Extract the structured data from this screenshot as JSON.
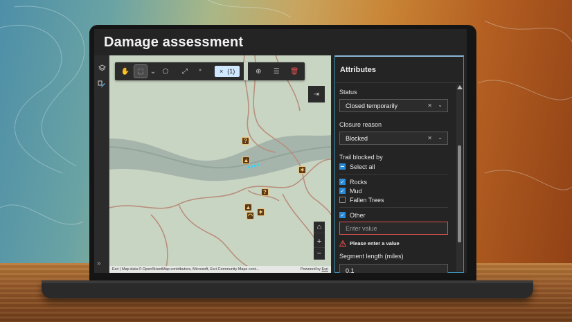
{
  "app": {
    "title": "Damage assessment"
  },
  "rail": {
    "expand_glyph": "»",
    "icons": [
      "layers-icon",
      "edit-feature-icon"
    ]
  },
  "toolbar": {
    "selection_count_label": "(1)",
    "clear_glyph": "×",
    "icons": [
      "pan-hand-icon",
      "select-rectangle-icon",
      "dropdown-chevron-icon",
      "select-by-polygon-icon",
      "select-by-line-icon",
      "select-by-point-icon",
      "zoom-to-icon",
      "filter-icon",
      "trash-icon"
    ]
  },
  "map": {
    "attribution_left": "Esri | Map data © OpenStreetMap contributors, Microsoft, Esri Community Maps cont...",
    "attribution_right_prefix": "Powered by ",
    "attribution_right_link": "Esri",
    "zoom_in": "+",
    "zoom_out": "−",
    "markers": [
      {
        "kind": "question-marker-icon",
        "glyph": "?"
      },
      {
        "kind": "closure-marker-icon",
        "glyph": "▲"
      },
      {
        "kind": "hazard-marker-icon",
        "glyph": "✶"
      },
      {
        "kind": "question-marker-icon",
        "glyph": "?"
      },
      {
        "kind": "closure-marker-icon",
        "glyph": "▲"
      },
      {
        "kind": "hazard-marker-icon",
        "glyph": "✶"
      },
      {
        "kind": "shelter-marker-icon",
        "glyph": "◠"
      }
    ],
    "colors": {
      "base": "#c9d5c3",
      "river": "#98a9a0",
      "trail": "#b89080",
      "selected_segment": "#3ad0f0"
    }
  },
  "panel": {
    "title": "Attributes",
    "status": {
      "label": "Status",
      "value": "Closed temporarily"
    },
    "closure_reason": {
      "label": "Closure reason",
      "value": "Blocked"
    },
    "trail_blocked_by": {
      "label": "Trail blocked by",
      "select_all": "Select all",
      "options": [
        {
          "label": "Rocks",
          "checked": true
        },
        {
          "label": "Mud",
          "checked": true
        },
        {
          "label": "Fallen Trees",
          "checked": false
        }
      ],
      "other": {
        "label": "Other",
        "checked": true
      },
      "other_placeholder": "Enter value",
      "error": "Please enter a value"
    },
    "segment_length": {
      "label": "Segment length (miles)",
      "value": "0.1"
    }
  },
  "colors": {
    "accent": "#2b8ad6",
    "error": "#d9534f",
    "panel_border": "#3d8fb4"
  }
}
